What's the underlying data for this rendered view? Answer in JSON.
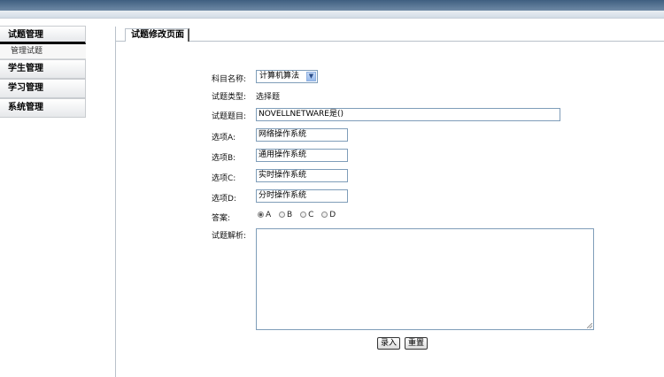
{
  "sidebar": {
    "groups": [
      {
        "label": "试题管理",
        "items": [
          "管理试题"
        ]
      },
      {
        "label": "学生管理",
        "items": []
      },
      {
        "label": "学习管理",
        "items": []
      },
      {
        "label": "系统管理",
        "items": []
      }
    ]
  },
  "panel": {
    "title": "试题修改页面"
  },
  "form": {
    "subject_label": "科目名称:",
    "subject_value": "计算机算法",
    "type_label": "试题类型:",
    "type_value": "选择题",
    "question_label": "试题题目:",
    "question_value": "NOVELLNETWARE是()",
    "option_a_label": "选项A:",
    "option_a_value": "网络操作系统",
    "option_b_label": "选项B:",
    "option_b_value": "通用操作系统",
    "option_c_label": "选项C:",
    "option_c_value": "实时操作系统",
    "option_d_label": "选项D:",
    "option_d_value": "分时操作系统",
    "answer_label": "答案:",
    "answer_options": [
      "A",
      "B",
      "C",
      "D"
    ],
    "answer_selected": "A",
    "analysis_label": "试题解析:",
    "analysis_value": ""
  },
  "buttons": {
    "submit": "录入",
    "reset": "重置"
  }
}
